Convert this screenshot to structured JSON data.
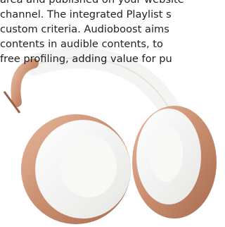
{
  "article": {
    "lines": [
      "area and published on your website",
      "channel. The integrated Playlist s",
      "custom criteria. Audioboost aims",
      "contents in audible contents, to",
      "free profiling, adding value for pu"
    ]
  },
  "image": {
    "subject": "headphones-photo",
    "colors": {
      "rose_gold": "#c98d6e",
      "cushion": "#f4f4f3",
      "background": "#ffffff"
    }
  }
}
